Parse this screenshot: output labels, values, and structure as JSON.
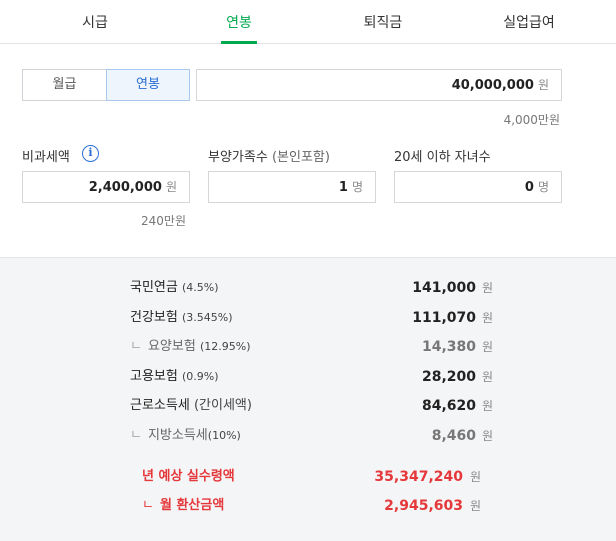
{
  "tabs": [
    {
      "label": "시급",
      "active": false
    },
    {
      "label": "연봉",
      "active": true
    },
    {
      "label": "퇴직금",
      "active": false
    },
    {
      "label": "실업급여",
      "active": false
    }
  ],
  "accent_color": "#03a94d",
  "salary_type": {
    "monthly": "월급",
    "annual": "연봉",
    "selected": "연봉"
  },
  "salary_input": {
    "value": "40,000,000",
    "unit": "원",
    "hint": "4,000만원"
  },
  "non_taxable": {
    "label": "비과세액",
    "icon": "info-icon",
    "value": "2,400,000",
    "unit": "원",
    "hint": "240만원"
  },
  "dependents": {
    "label": "부양가족수",
    "label_sub": "(본인포함)",
    "value": "1",
    "unit": "명"
  },
  "children": {
    "label": "20세 이하 자녀수",
    "value": "0",
    "unit": "명"
  },
  "deductions": [
    {
      "name": "국민연금",
      "pct": "(4.5%)",
      "amount": "141,000",
      "unit": "원",
      "sub": false
    },
    {
      "name": "건강보험",
      "pct": "(3.545%)",
      "amount": "111,070",
      "unit": "원",
      "sub": false
    },
    {
      "name": "요양보험",
      "pct": "(12.95%)",
      "amount": "14,380",
      "unit": "원",
      "sub": true
    },
    {
      "name": "고용보험",
      "pct": "(0.9%)",
      "amount": "28,200",
      "unit": "원",
      "sub": false
    },
    {
      "name": "근로소득세",
      "pct": "(간이세액)",
      "amount": "84,620",
      "unit": "원",
      "sub": false
    },
    {
      "name": "지방소득세",
      "pct": "(10%)",
      "amount": "8,460",
      "unit": "원",
      "sub": true
    }
  ],
  "net_annual": {
    "label": "년 예상 실수령액",
    "amount": "35,347,240",
    "unit": "원"
  },
  "net_monthly": {
    "label": "월 환산금액",
    "amount": "2,945,603",
    "unit": "원"
  },
  "highlight_color": "#e5383b"
}
